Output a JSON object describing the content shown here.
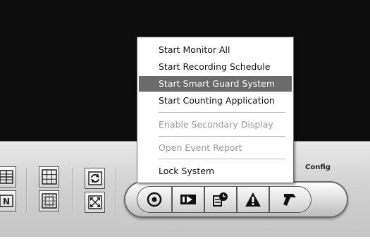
{
  "context_menu": {
    "items": [
      {
        "label": "Start Monitor All",
        "state": "normal"
      },
      {
        "label": "Start Recording Schedule",
        "state": "normal"
      },
      {
        "label": "Start Smart Guard System",
        "state": "selected"
      },
      {
        "label": "Start Counting Application",
        "state": "normal"
      },
      {
        "label": "Enable Secondary Display",
        "state": "disabled"
      },
      {
        "label": "Open Event Report",
        "state": "disabled"
      },
      {
        "label": "Lock System",
        "state": "normal"
      }
    ]
  },
  "control_panel": {
    "config_label": "Config",
    "layout_buttons": [
      "grid-4-icon",
      "grid-9-icon",
      "grid-16-icon",
      "single-view-icon",
      "screen-n-icon",
      "auto-cycle-icon",
      "fullscreen-icon"
    ],
    "toolbar_buttons": [
      "start-icon",
      "playback-icon",
      "schedule-icon",
      "alarm-icon",
      "config-icon"
    ]
  },
  "colors": {
    "video_background": "#0d0d0d",
    "menu_highlight": "#6b6b6b",
    "disabled_text": "#9a9a9a"
  }
}
